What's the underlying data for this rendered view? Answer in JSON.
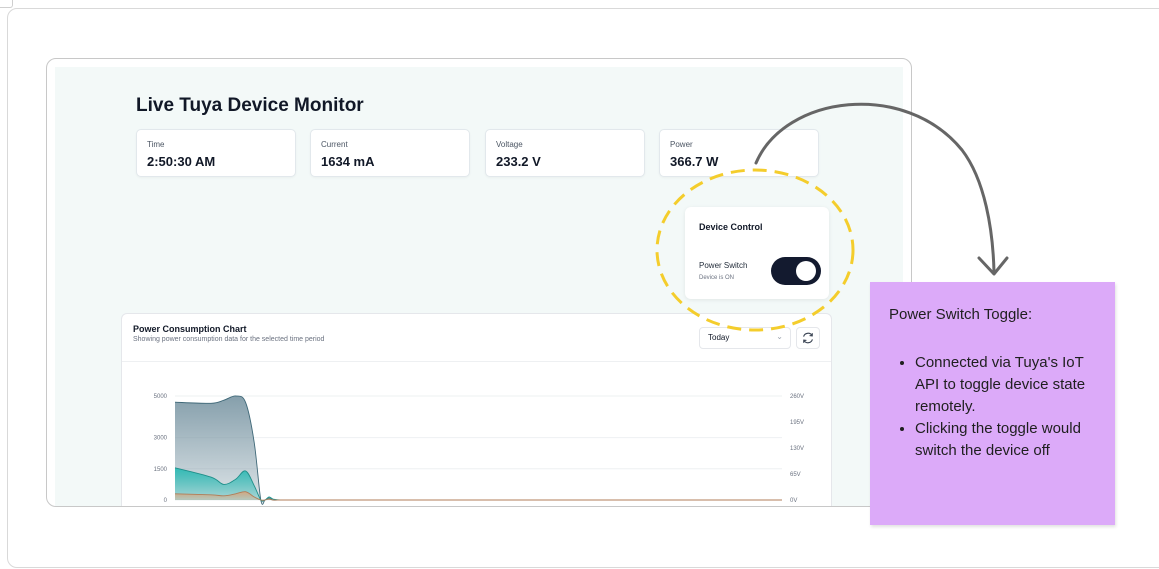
{
  "app": {
    "title": "Live Tuya Device Monitor"
  },
  "stats": [
    {
      "label": "Time",
      "value": "2:50:30 AM"
    },
    {
      "label": "Current",
      "value": "1634 mA"
    },
    {
      "label": "Voltage",
      "value": "233.2 V"
    },
    {
      "label": "Power",
      "value": "366.7 W"
    }
  ],
  "device_control": {
    "title": "Device Control",
    "switch_label": "Power Switch",
    "switch_status": "Device is ON",
    "switch_on": true
  },
  "chart_card": {
    "title": "Power Consumption Chart",
    "subtitle": "Showing power consumption data for the selected time period",
    "period_selected": "Today"
  },
  "chart_data": {
    "type": "area",
    "title": "Power Consumption Chart",
    "left_axis_ticks": [
      "5000",
      "3000",
      "1500",
      "0"
    ],
    "right_axis_ticks": [
      "260V",
      "195V",
      "130V",
      "65V",
      "0V"
    ],
    "ylim_left": [
      0,
      5000
    ],
    "ylim_right": [
      0,
      260
    ],
    "grid": true,
    "x": [
      0,
      0.35,
      0.65,
      1,
      1.35,
      1.7,
      2,
      2.2,
      2.4,
      2.6,
      3,
      3.5,
      4,
      6,
      10,
      20,
      40,
      60,
      80,
      100
    ],
    "series": [
      {
        "values": [
          4700,
          4650,
          4800,
          5000,
          4700,
          2800,
          0,
          0,
          100,
          0,
          0,
          0,
          0,
          0,
          0,
          0,
          0,
          0,
          0,
          0
        ],
        "color": "#7f9aa7"
      },
      {
        "values": [
          1550,
          1100,
          750,
          1000,
          1400,
          700,
          0,
          0,
          150,
          50,
          0,
          0,
          0,
          0,
          0,
          0,
          0,
          0,
          0,
          0
        ],
        "color": "#2bb9b3"
      },
      {
        "values": [
          300,
          250,
          200,
          300,
          400,
          150,
          0,
          0,
          50,
          0,
          0,
          0,
          0,
          0,
          0,
          0,
          0,
          0,
          0,
          0
        ],
        "color": "#d9a77f"
      }
    ]
  },
  "annotation": {
    "title": "Power Switch Toggle:",
    "bullets": [
      "Connected via Tuya's IoT API to toggle device state remotely.",
      "Clicking the toggle would switch the device off"
    ]
  },
  "colors": {
    "background": "#f3f9f8",
    "toggle_on": "#131a2f",
    "highlight_ring": "#f4cd2c",
    "annotation_bg": "#dcaaf9",
    "arrow": "#666666"
  }
}
